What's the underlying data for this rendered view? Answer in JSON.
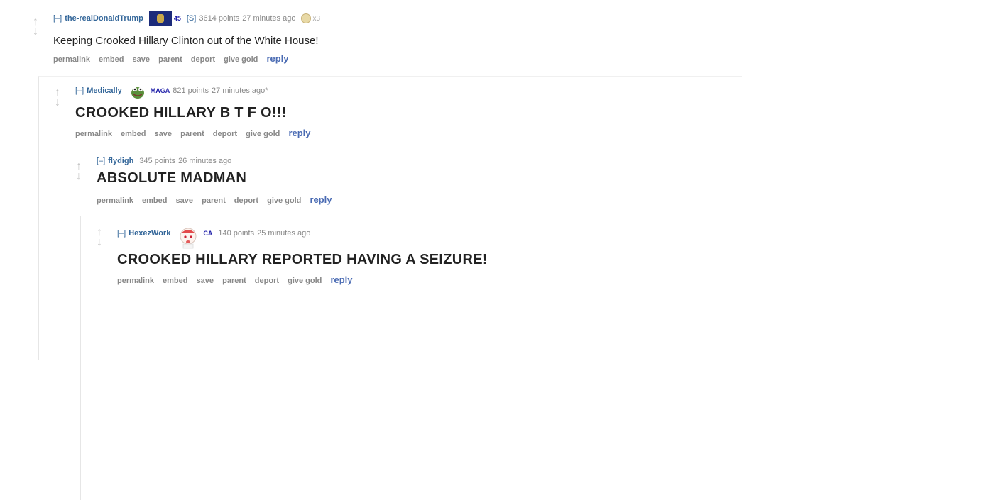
{
  "comments": [
    {
      "expand": "[–]",
      "author": "the-realDonaldTrump",
      "flair": "45",
      "stickied": "[S]",
      "score": "3614 points",
      "time": "27 minutes ago",
      "gold_count": "x3",
      "body": "Keeping Crooked Hillary Clinton out of the White House!"
    },
    {
      "expand": "[–]",
      "author": "Medically",
      "flair": "MAGA",
      "score": "821 points",
      "time": "27 minutes ago*",
      "body": "CROOKED HILLARY B T F O!!!"
    },
    {
      "expand": "[–]",
      "author": "flydigh",
      "score": "345 points",
      "time": "26 minutes ago",
      "body": "ABSOLUTE MADMAN"
    },
    {
      "expand": "[–]",
      "author": "HexezWork",
      "flair": "CA",
      "score": "140 points",
      "time": "25 minutes ago",
      "body": "CROOKED HILLARY REPORTED HAVING A SEIZURE!"
    }
  ],
  "buttons": {
    "permalink": "permalink",
    "embed": "embed",
    "save": "save",
    "parent": "parent",
    "deport": "deport",
    "give_gold": "give gold",
    "reply": "reply"
  },
  "icons": {
    "upvote": "upvote-arrow-icon",
    "downvote": "downvote-arrow-icon",
    "gold": "gold-award-icon"
  },
  "colors": {
    "author": "#336699",
    "flair": "#2222aa",
    "reply": "#4a6bb3",
    "meta": "#888888"
  }
}
